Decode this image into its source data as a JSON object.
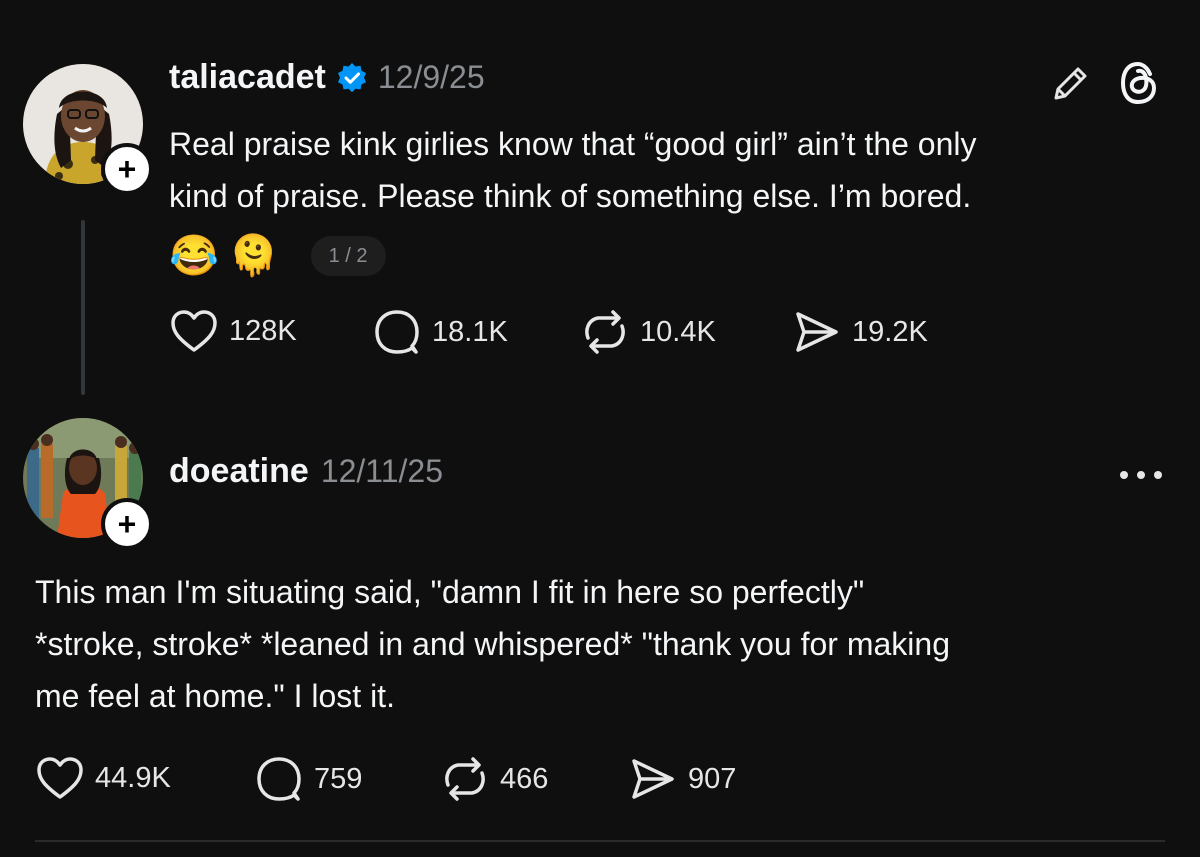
{
  "post1": {
    "username": "taliacadet",
    "date": "12/9/25",
    "verified": true,
    "text": "Real praise kink girlies know that “good girl” ain’t the only\nkind of praise. Please think of something else. I’m bored.",
    "emojis": [
      "😂",
      "🫠"
    ],
    "emoji_names": [
      "face-with-tears-of-joy",
      "melting-face"
    ],
    "pager": "1 / 2",
    "likes": "128K",
    "replies": "18.1K",
    "reposts": "10.4K",
    "shares": "19.2K"
  },
  "post2": {
    "username": "doeatine",
    "date": "12/11/25",
    "text": "This man I'm situating said, \"damn I fit in here so perfectly\"\n*stroke, stroke* *leaned in and whispered* \"thank you for making\nme feel at home.\" I lost it.",
    "likes": "44.9K",
    "replies": "759",
    "reposts": "466",
    "shares": "907"
  },
  "icons": {
    "verified": "verified-badge-icon",
    "edit": "pencil-icon",
    "app": "threads-logo-icon",
    "more": "more-dots-icon",
    "like": "heart-icon",
    "reply": "comment-icon",
    "repost": "repost-icon",
    "share": "send-icon"
  },
  "colors": {
    "background": "#0f0f0f",
    "text": "#f3f5f7",
    "muted": "#8a8d91",
    "verified": "#0095f6"
  }
}
